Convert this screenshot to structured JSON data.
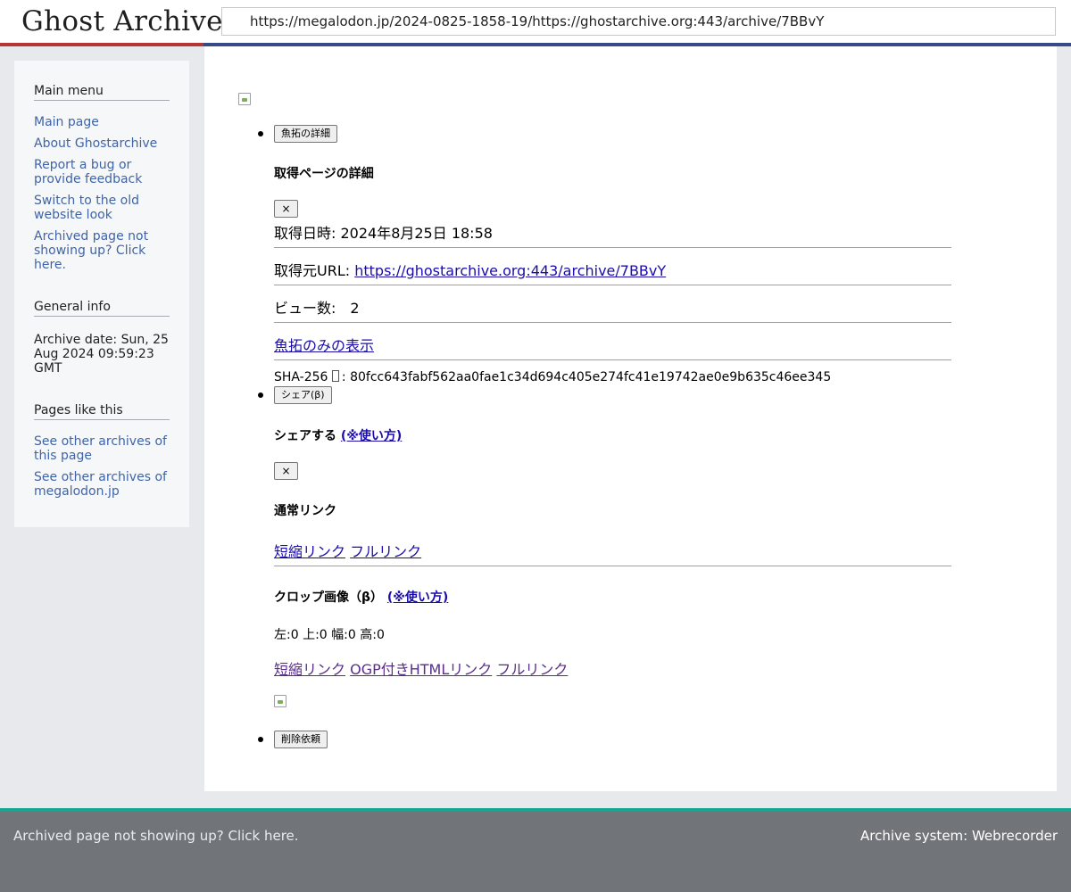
{
  "header": {
    "logo": "Ghost Archive",
    "url": "https://megalodon.jp/2024-0825-1858-19/https://ghostarchive.org:443/archive/7BBvY"
  },
  "sidebar": {
    "main_menu": {
      "heading": "Main menu",
      "links": [
        "Main page",
        "About Ghostarchive",
        "Report a bug or provide feedback",
        "Switch to the old website look",
        "Archived page not showing up? Click here."
      ]
    },
    "general_info": {
      "heading": "General info",
      "archive_date": "Archive date: Sun, 25 Aug 2024 09:59:23 GMT"
    },
    "pages_like_this": {
      "heading": "Pages like this",
      "links": [
        "See other archives of this page",
        "See other archives of megalodon.jp"
      ]
    }
  },
  "main": {
    "details_button": "魚拓の詳細",
    "details_heading": "取得ページの詳細",
    "close_label": "×",
    "capture_date": "取得日時: 2024年8月25日 18:58",
    "source_url_label": "取得元URL: ",
    "source_url": "https://ghostarchive.org:443/archive/7BBvY",
    "view_count": "ビュー数:　2",
    "gyotaku_only_link": "魚拓のみの表示",
    "sha_label": "SHA-256 ",
    "sha_sep": ": ",
    "sha_value": "80fcc643fabf562aa0fae1c34d694c405e274fc41e19742ae0e9b635c46ee345",
    "share_button": "シェア(β)",
    "share_heading": "シェアする",
    "howto_link": "(※使い方)",
    "normal_link_heading": "通常リンク",
    "short_link": "短縮リンク",
    "full_link": "フルリンク",
    "crop_heading": "クロップ画像（β）",
    "crop_values": "左:0 上:0 幅:0 高:0",
    "ogp_link": "OGP付きHTMLリンク",
    "delete_button": "削除依頼"
  },
  "footer": {
    "left": "Archived page not showing up? Click here.",
    "right": "Archive system: Webrecorder"
  },
  "colors": {
    "link": "#1a0dab",
    "sidebar_link": "#3f64a8",
    "red_stripe": "#b53634",
    "blue_stripe": "#354a86",
    "footer_stripe": "#14a68e",
    "footer_bg": "#717579"
  }
}
